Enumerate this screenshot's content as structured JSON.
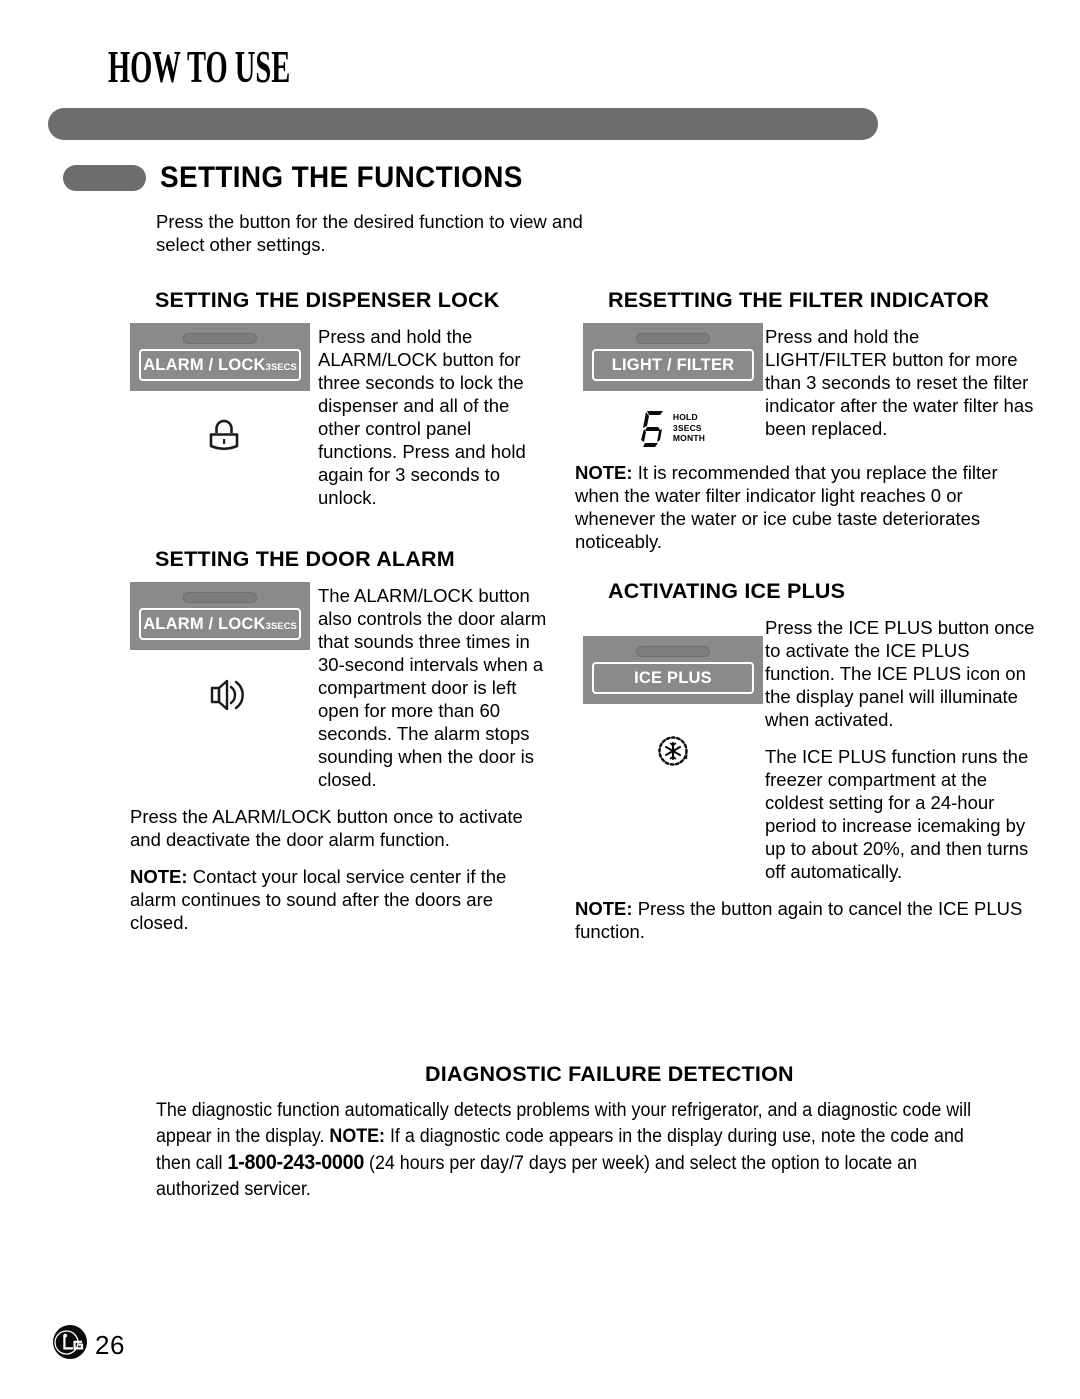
{
  "header": {
    "title": "HOW TO USE",
    "section_title": "SETTING THE FUNCTIONS",
    "intro": "Press the button for the desired function to view and select other settings."
  },
  "left_column": {
    "dispenser_lock": {
      "heading": "SETTING THE DISPENSER LOCK",
      "button_label": "ALARM / LOCK",
      "button_secs": "3SECS",
      "icon": "padlock-icon",
      "text": "Press and hold the ALARM/LOCK button for three seconds to lock the dispenser and all of the other control panel functions. Press and hold again for 3 seconds to unlock."
    },
    "door_alarm": {
      "heading": "SETTING THE DOOR ALARM",
      "button_label": "ALARM / LOCK",
      "button_secs": "3SECS",
      "icon": "speaker-icon",
      "text": "The ALARM/LOCK button also controls the door alarm that sounds three times in 30-second intervals when a compartment door is  left open for more than 60 seconds. The alarm stops sounding when the door is closed.",
      "para2": "Press the ALARM/LOCK button once to activate and deactivate the door alarm function.",
      "note_label": "NOTE:",
      "note_text": " Contact your local service center if the alarm continues to sound after the doors are closed."
    }
  },
  "right_column": {
    "filter_indicator": {
      "heading": "RESETTING THE FILTER INDICATOR",
      "button_label": "LIGHT / FILTER",
      "icon": "seven-segment-six-icon",
      "seg_digit": "6",
      "seg_labels": [
        "HOLD",
        "3SECS",
        "MONTH"
      ],
      "text": "Press and hold the LIGHT/FILTER button for more than 3 seconds to reset the filter indicator after the water filter has been replaced.",
      "note_label": "NOTE:",
      "note_text": " It is recommended that you replace the filter when the water filter indicator light reaches 0 or whenever the water or ice cube taste deteriorates noticeably."
    },
    "ice_plus": {
      "heading": "ACTIVATING ICE PLUS",
      "button_label": "ICE PLUS",
      "icon": "snowflake-refresh-icon",
      "text": "Press the ICE PLUS button once to activate the ICE PLUS function. The ICE PLUS icon on the display panel will illuminate when activated.",
      "para2": "The ICE PLUS function runs the freezer compartment at the coldest setting for a 24-hour period to increase icemaking by up to about 20%, and then turns off automatically.",
      "note_label": "NOTE:",
      "note_text": " Press the button again to cancel the ICE PLUS function."
    }
  },
  "diagnostic": {
    "heading": "DIAGNOSTIC FAILURE DETECTION",
    "text_1": "The diagnostic function automatically detects problems with your refrigerator, and a diagnostic code will appear in the display. ",
    "note_label": "NOTE:",
    "text_2": " If a diagnostic code appears in the display during use, note the code and then call ",
    "phone": "1-800-243-0000",
    "text_3": " (24 hours per day/7 days per week) and select the option to locate an authorized servicer."
  },
  "footer": {
    "brand": "LG",
    "page_number": "26"
  },
  "colors": {
    "bar_gray": "#6d6d6d",
    "panel_gray": "#8a8a8a",
    "led_gray": "#7d7d7d"
  }
}
